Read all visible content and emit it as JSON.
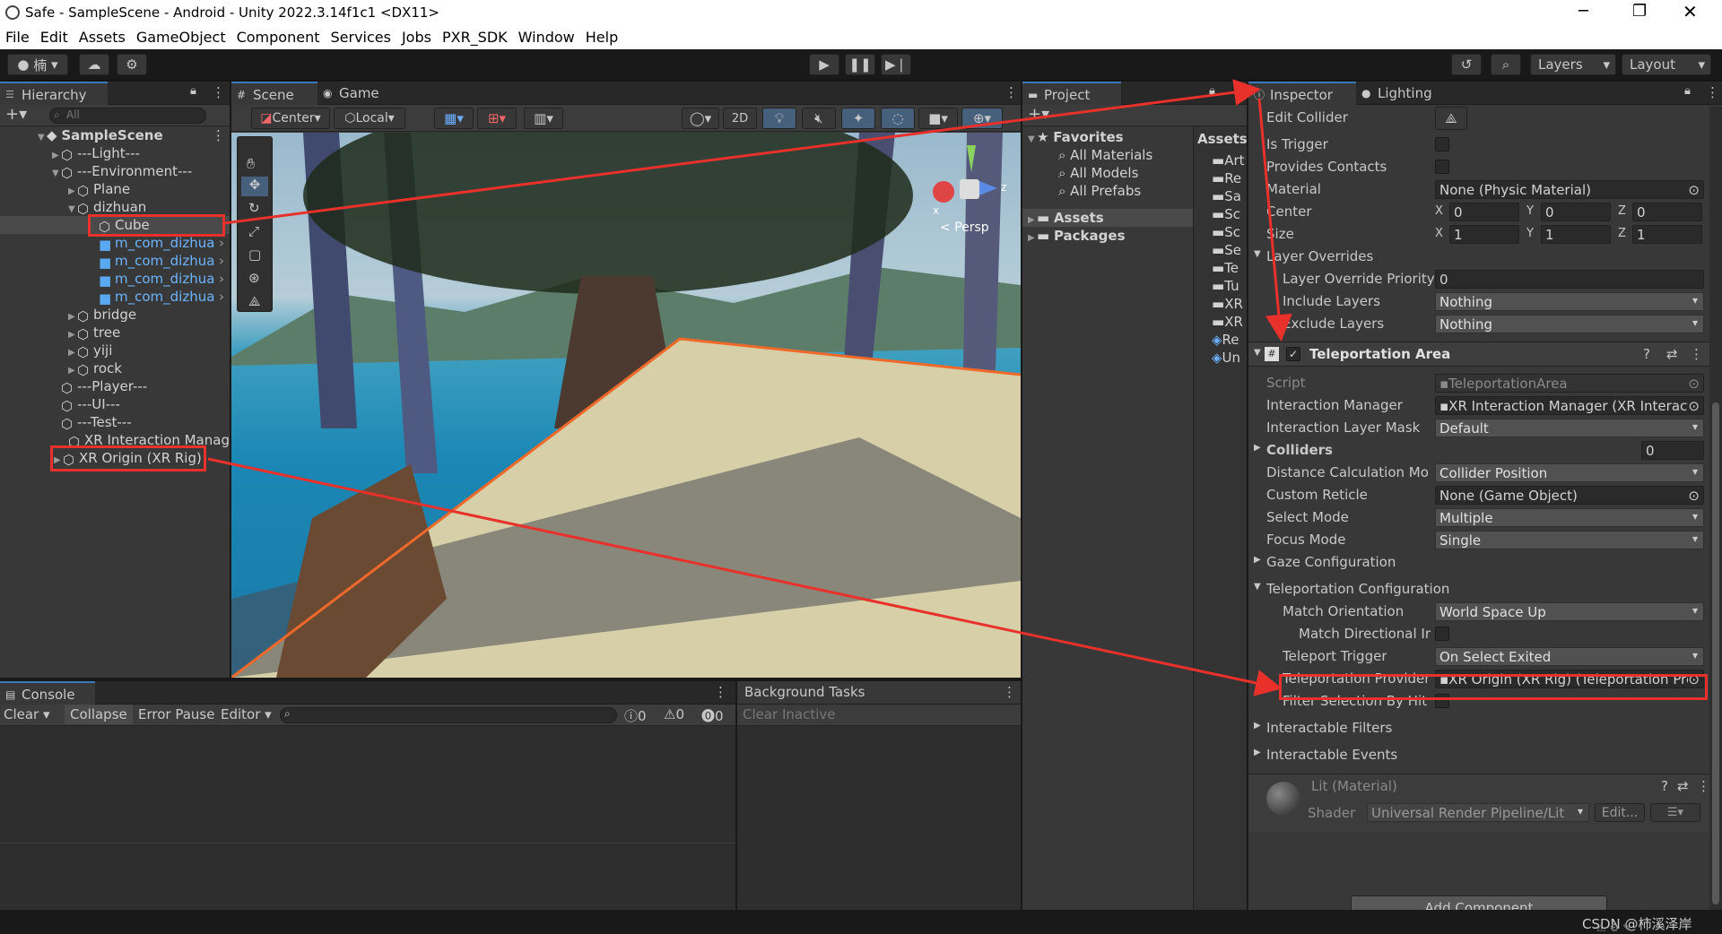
{
  "window": {
    "title": "Safe - SampleScene - Android - Unity 2022.3.14f1c1 <DX11>"
  },
  "menu": [
    "File",
    "Edit",
    "Assets",
    "GameObject",
    "Component",
    "Services",
    "Jobs",
    "PXR_SDK",
    "Window",
    "Help"
  ],
  "toolbar": {
    "account": "楠",
    "layers": "Layers",
    "layout": "Layout"
  },
  "hierarchy": {
    "tab": "Hierarchy",
    "search_placeholder": "All",
    "items": [
      {
        "label": "SampleScene"
      },
      {
        "label": "---Light---"
      },
      {
        "label": "---Environment---"
      },
      {
        "label": "Plane"
      },
      {
        "label": "dizhuan"
      },
      {
        "label": "Cube"
      },
      {
        "label": "m_com_dizhua"
      },
      {
        "label": "m_com_dizhua"
      },
      {
        "label": "m_com_dizhua"
      },
      {
        "label": "m_com_dizhua"
      },
      {
        "label": "bridge"
      },
      {
        "label": "tree"
      },
      {
        "label": "yiji"
      },
      {
        "label": "rock"
      },
      {
        "label": "---Player---"
      },
      {
        "label": "---UI---"
      },
      {
        "label": "---Test---"
      },
      {
        "label": "XR Interaction Manage"
      },
      {
        "label": "XR Origin (XR Rig)"
      }
    ]
  },
  "scene": {
    "tabs": [
      "Scene",
      "Game"
    ],
    "pivot": "Center",
    "space": "Local",
    "mode2d": "2D",
    "persp": "Persp",
    "gizmo_x": "x",
    "gizmo_z": "z"
  },
  "project": {
    "tab": "Project",
    "favorites": "Favorites",
    "fav_items": [
      "All Materials",
      "All Models",
      "All Prefabs"
    ],
    "roots": [
      "Assets",
      "Packages"
    ],
    "assets_header": "Assets",
    "asset_items": [
      "Art",
      "Re",
      "Sa",
      "Sc",
      "Sc",
      "Se",
      "Te",
      "Tu",
      "XR",
      "XR",
      "Re",
      "Un"
    ]
  },
  "inspector": {
    "tabs": [
      "Inspector",
      "Lighting"
    ],
    "edit_collider": "Edit Collider",
    "is_trigger": "Is Trigger",
    "provides_contacts": "Provides Contacts",
    "material_label": "Material",
    "material_value": "None (Physic Material)",
    "center_label": "Center",
    "center": {
      "x": "0",
      "y": "0",
      "z": "0"
    },
    "size_label": "Size",
    "size": {
      "x": "1",
      "y": "1",
      "z": "1"
    },
    "axis": {
      "x": "X",
      "y": "Y",
      "z": "Z"
    },
    "layer_overrides": "Layer Overrides",
    "layer_priority_label": "Layer Override Priority",
    "layer_priority": "0",
    "include_layers_label": "Include Layers",
    "include_layers": "Nothing",
    "exclude_layers_label": "Exclude Layers",
    "exclude_layers": "Nothing",
    "component": "Teleportation Area",
    "script_label": "Script",
    "script_value": "TeleportationArea",
    "rows": [
      {
        "label": "Interaction Manager",
        "value": "XR Interaction Manager (XR Interact"
      },
      {
        "label": "Interaction Layer Mask",
        "value": "Default"
      },
      {
        "label": "Colliders",
        "value": "0"
      },
      {
        "label": "Distance Calculation Mo",
        "value": "Collider Position"
      },
      {
        "label": "Custom Reticle",
        "value": "None (Game Object)"
      },
      {
        "label": "Select Mode",
        "value": "Multiple"
      },
      {
        "label": "Focus Mode",
        "value": "Single"
      }
    ],
    "gaze_configuration": "Gaze Configuration",
    "teleport_configuration": "Teleportation Configuration",
    "match_orientation_label": "Match Orientation",
    "match_orientation": "World Space Up",
    "match_directional_label": "Match Directional Ir",
    "teleport_trigger_label": "Teleport Trigger",
    "teleport_trigger": "On Select Exited",
    "teleport_provider_label": "Teleportation Provider",
    "teleport_provider": "XR Origin (XR Rig) (Teleportation Prc",
    "filter_selection": "Filter Selection By Hit",
    "interactable_filters": "Interactable Filters",
    "interactable_events": "Interactable Events",
    "material_name": "Lit (Material)",
    "shader_label": "Shader",
    "shader_value": "Universal Render Pipeline/Lit",
    "edit_btn": "Edit...",
    "add_component": "Add Component"
  },
  "console": {
    "tab": "Console",
    "clear": "Clear",
    "collapse": "Collapse",
    "error_pause": "Error Pause",
    "editor": "Editor",
    "counts": [
      "0",
      "0",
      "0"
    ]
  },
  "background_tasks": {
    "title": "Background Tasks",
    "clear_inactive": "Clear Inactive"
  },
  "watermark": "CSDN @柿溪泽岸"
}
